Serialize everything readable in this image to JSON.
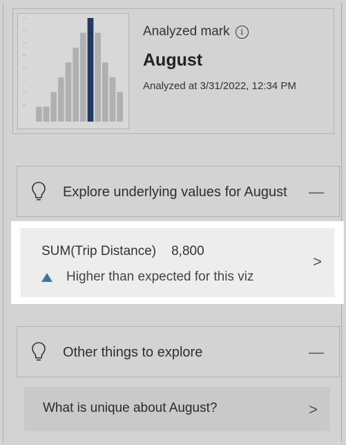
{
  "analyzed_mark": {
    "label": "Analyzed mark",
    "title": "August",
    "analyzed_at": "Analyzed at 3/31/2022, 12:34 PM"
  },
  "thumbnail_chart": {
    "type": "bar",
    "values": [
      1,
      1,
      2,
      3,
      4,
      5,
      6,
      7,
      6,
      4,
      3,
      2
    ],
    "highlight_index": 7,
    "colors": {
      "bar": "#b0b0b0",
      "highlight": "#1f3b63"
    }
  },
  "explore_section": {
    "label": "Explore underlying values for August",
    "collapse": "—"
  },
  "value_card": {
    "metric": "SUM(Trip Distance)",
    "value": "8,800",
    "insight": "Higher than expected for this viz",
    "chevron": ">"
  },
  "other_section": {
    "label": "Other things to explore",
    "collapse": "—"
  },
  "unique_card": {
    "question": "What is unique about August?",
    "chevron": ">"
  },
  "colors": {
    "background": "#d3d3d3",
    "accent_triangle": "#3b7a9a",
    "highlight_bar": "#1f3b63"
  }
}
